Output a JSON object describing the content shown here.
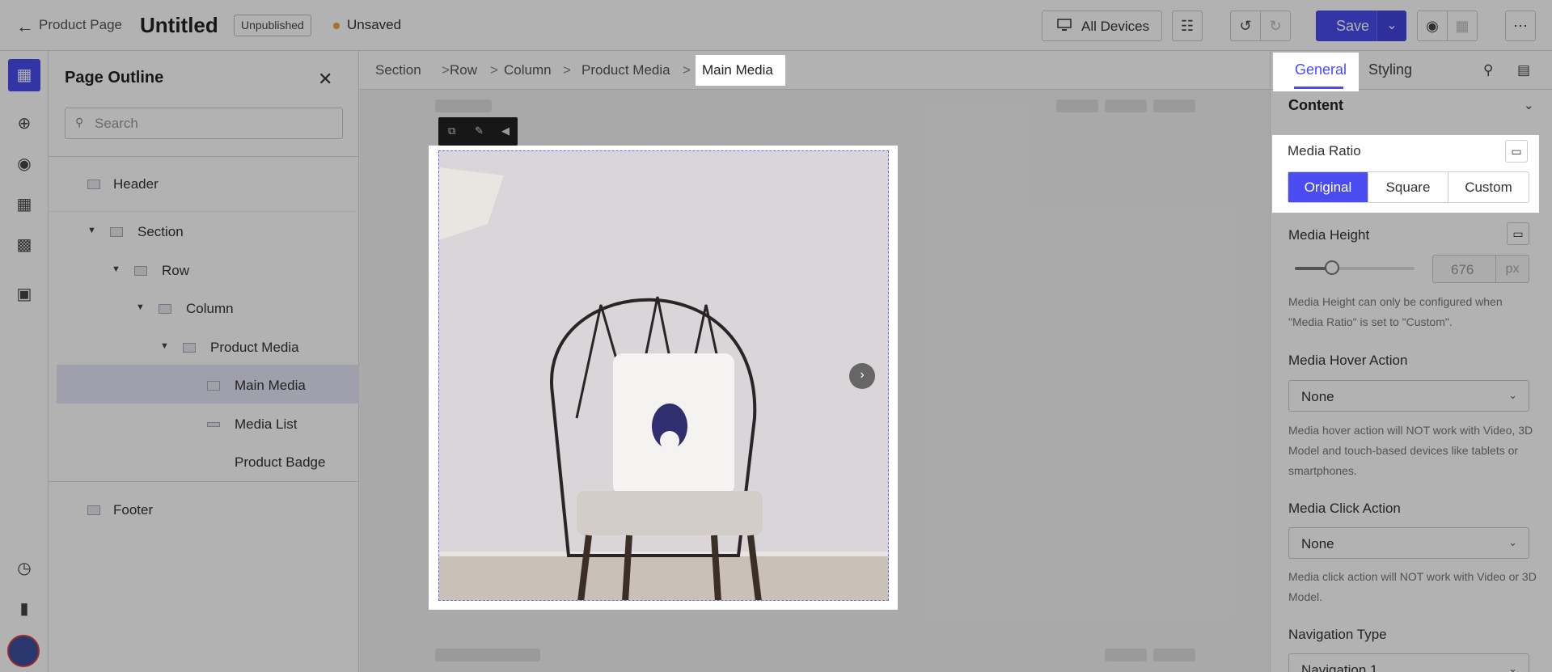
{
  "topbar": {
    "back_label": "Product Page",
    "title": "Untitled",
    "status_badge": "Unpublished",
    "save_status": "Unsaved",
    "devices_label": "All Devices",
    "save_label": "Save"
  },
  "rail": {
    "icons": [
      "page-outline-icon",
      "add-element-icon",
      "shopify-icon",
      "layout-icon",
      "apps-icon",
      "folder-icon",
      "history-icon",
      "terminal-icon"
    ]
  },
  "outline": {
    "title": "Page Outline",
    "search_placeholder": "Search",
    "items": [
      {
        "label": "Header"
      },
      {
        "label": "Section"
      },
      {
        "label": "Row"
      },
      {
        "label": "Column"
      },
      {
        "label": "Product Media"
      },
      {
        "label": "Main Media"
      },
      {
        "label": "Media List"
      },
      {
        "label": "Product Badge"
      },
      {
        "label": "Footer"
      }
    ]
  },
  "canvas": {
    "breadcrumb": [
      "Section",
      "Row",
      "Column",
      "Product Media",
      "Main Media"
    ]
  },
  "right": {
    "tabs": [
      "General",
      "Styling"
    ],
    "section_title": "Content",
    "media_ratio": {
      "label": "Media Ratio",
      "options": [
        "Original",
        "Square",
        "Custom"
      ],
      "selected": "Original"
    },
    "media_height": {
      "label": "Media Height",
      "value": "676",
      "unit": "px",
      "help": "Media Height can only be configured when \"Media Ratio\" is set to \"Custom\"."
    },
    "hover_action": {
      "label": "Media Hover Action",
      "value": "None",
      "help": "Media hover action will NOT work with Video, 3D Model and touch-based devices like tablets or smartphones."
    },
    "click_action": {
      "label": "Media Click Action",
      "value": "None",
      "help": "Media click action will NOT work with Video or 3D Model."
    },
    "navigation": {
      "label": "Navigation Type",
      "value": "Navigation 1"
    }
  },
  "colors": {
    "accent": "#4a4cf0"
  }
}
